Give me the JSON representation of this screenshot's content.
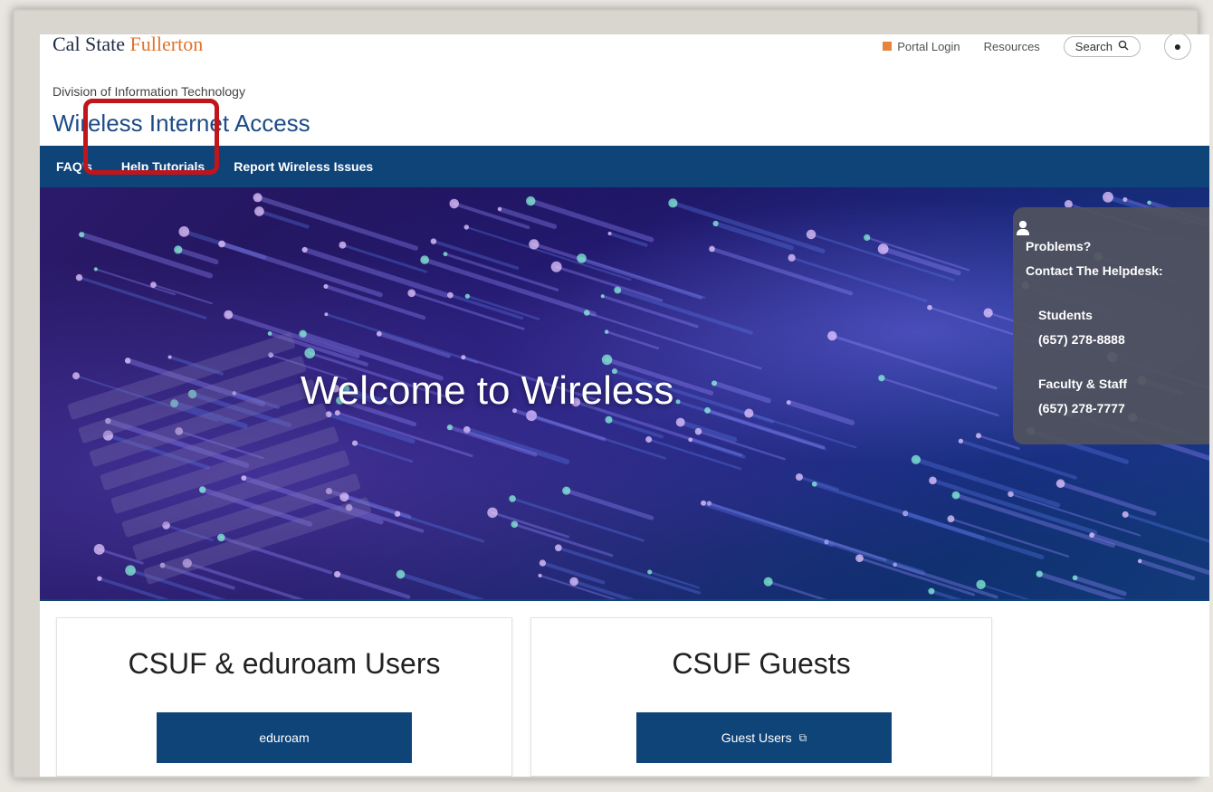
{
  "header": {
    "logo_main": "Cal State ",
    "logo_accent": "Fullerton",
    "portal_login": "Portal Login",
    "resources": "Resources",
    "search": "Search",
    "division": "Division of Information Technology",
    "site_title": "Wireless Internet Access"
  },
  "nav": {
    "items": [
      "FAQ's",
      "Help Tutorials",
      "Report Wireless Issues"
    ]
  },
  "hero": {
    "title": "Welcome to Wireless"
  },
  "helpdesk": {
    "line1": "Problems?",
    "line2": "Contact The Helpdesk:",
    "students_label": "Students",
    "students_phone": "(657) 278-8888",
    "faculty_label": "Faculty & Staff",
    "faculty_phone": "(657) 278-7777"
  },
  "cards": [
    {
      "title": "CSUF & eduroam Users",
      "button": "eduroam"
    },
    {
      "title": "CSUF Guests",
      "button": "Guest Users"
    }
  ],
  "colors": {
    "nav_bg": "#0f4479",
    "title_blue": "#1d4b86",
    "highlight_red": "#c0161b",
    "accent_orange": "#e0742a"
  }
}
